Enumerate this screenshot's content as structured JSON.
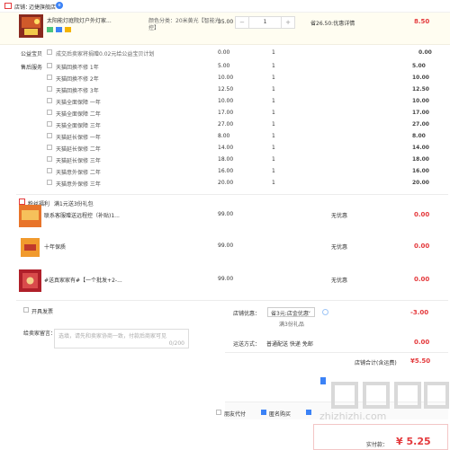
{
  "shop": {
    "label": "店铺：",
    "name": "迈捷旗舰店",
    "badge": "e"
  },
  "main_item": {
    "title": "太阳能灯庭院灯户外灯家...",
    "spec": "颜色分类：20米黄光【智能光控】",
    "price": "35.00",
    "qty": "1",
    "save": "省26.50:优惠详情",
    "subtotal": "8.50",
    "mini_icons": [
      "7-icon",
      "price-guarantee-icon",
      "card-icon"
    ],
    "colors": {
      "accent": "#e4393c",
      "row_bg": "#fffdf1"
    }
  },
  "charity": {
    "label": "公益宝贝",
    "text": "成交后卖家将捐赠0.02元给公益宝贝计划",
    "price": "0.00",
    "qty": "1",
    "subtotal": "0.00"
  },
  "services": {
    "label": "售后服务",
    "items": [
      {
        "name": "天猫回换不修 1年",
        "price": "5.00",
        "qty": "1",
        "subtotal": "5.00"
      },
      {
        "name": "天猫回换不修 2年",
        "price": "10.00",
        "qty": "1",
        "subtotal": "10.00"
      },
      {
        "name": "天猫回换不修 3年",
        "price": "12.50",
        "qty": "1",
        "subtotal": "12.50"
      },
      {
        "name": "天猫全面保障 一年",
        "price": "10.00",
        "qty": "1",
        "subtotal": "10.00"
      },
      {
        "name": "天猫全面保障 二年",
        "price": "17.00",
        "qty": "1",
        "subtotal": "17.00"
      },
      {
        "name": "天猫全面保障 三年",
        "price": "27.00",
        "qty": "1",
        "subtotal": "27.00"
      },
      {
        "name": "天猫延长保修 一年",
        "price": "8.00",
        "qty": "1",
        "subtotal": "8.00"
      },
      {
        "name": "天猫延长保修 二年",
        "price": "14.00",
        "qty": "1",
        "subtotal": "14.00"
      },
      {
        "name": "天猫延长保修 三年",
        "price": "18.00",
        "qty": "1",
        "subtotal": "18.00"
      },
      {
        "name": "天猫意外保修 二年",
        "price": "16.00",
        "qty": "1",
        "subtotal": "16.00"
      },
      {
        "name": "天猫意外保修 三年",
        "price": "20.00",
        "qty": "1",
        "subtotal": "20.00"
      }
    ]
  },
  "gifts": {
    "header_label": "粉丝福利",
    "header_text": "满1元送3份礼包",
    "items": [
      {
        "name": "联系客服赠送远程控（补贴)1...",
        "price": "99.00",
        "qty": "1",
        "discount": "无优惠",
        "subtotal": "0.00"
      },
      {
        "name": "十年保质",
        "price": "99.00",
        "qty": "1",
        "discount": "无优惠",
        "subtotal": "0.00"
      },
      {
        "name": "#送真家家有#【一个批发+2-...",
        "price": "99.00",
        "qty": "1",
        "discount": "无优惠",
        "subtotal": "0.00"
      }
    ]
  },
  "invoice": {
    "label": "开具发票"
  },
  "shop_discount": {
    "label": "店铺优惠：",
    "selected": "省3元:店金优惠",
    "sub": "满3份礼品",
    "amount": "-3.00"
  },
  "message": {
    "label": "给卖家留言：",
    "placeholder": "选填，请先和卖家协商一致，付款后商家可见",
    "counter": "0/200"
  },
  "delivery": {
    "label": "运送方式：",
    "value": "普通配送 快递 免邮",
    "amount": "0.00"
  },
  "shop_total": {
    "label": "店铺合计(含运费)",
    "amount": "¥5.50"
  },
  "footer": {
    "anon_label": "匿名购买",
    "options": [
      {
        "label": "朋友代付",
        "checked": false
      },
      {
        "label": "匿名购买",
        "checked": true
      }
    ],
    "pay_label": "实付款：",
    "pay_amount": "¥ 5.25"
  }
}
